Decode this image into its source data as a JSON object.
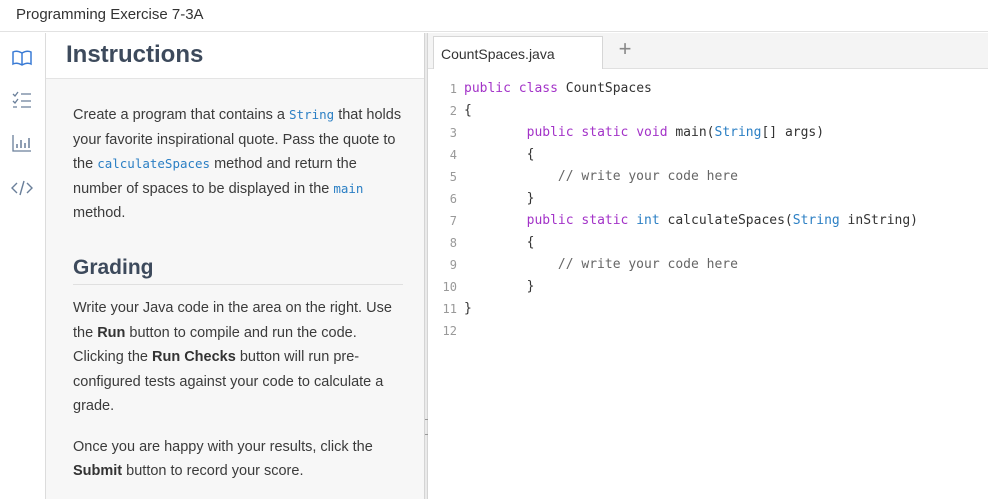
{
  "window": {
    "title": "Programming Exercise 7-3A"
  },
  "rail": {
    "icons": [
      "book-icon",
      "checklist-icon",
      "chart-icon",
      "code-icon"
    ]
  },
  "instructions": {
    "heading": "Instructions",
    "intro": [
      "Create a program that contains a ",
      "String",
      " that holds your favorite inspirational quote. Pass the quote to the ",
      "calculateSpaces",
      " method and return the number of spaces to be displayed in the ",
      "main",
      " method."
    ],
    "grading_heading": "Grading",
    "grading": [
      "Write your Java code in the area on the right. Use the ",
      "Run",
      " button to compile and run the code. Clicking the ",
      "Run Checks",
      " button will run pre-configured tests against your code to calculate a grade."
    ],
    "closing": [
      "Once you are happy with your results, click the ",
      "Submit",
      " button to record your score."
    ]
  },
  "editor": {
    "tab_label": "CountSpaces.java",
    "add_tab": "+",
    "lines": [
      {
        "n": "1",
        "tokens": [
          [
            "kw",
            "public"
          ],
          [
            "",
            ""
          ],
          [
            "",
            ""
          ],
          [
            "",
            " "
          ],
          [
            "kw",
            "class"
          ],
          [
            "",
            " CountSpaces"
          ]
        ]
      },
      {
        "n": "2",
        "tokens": [
          [
            "",
            "{"
          ]
        ]
      },
      {
        "n": "3",
        "tokens": [
          [
            "",
            "        "
          ],
          [
            "kw",
            "public"
          ],
          [
            "",
            " "
          ],
          [
            "kw",
            "static"
          ],
          [
            "",
            " "
          ],
          [
            "kw",
            "void"
          ],
          [
            "",
            " main("
          ],
          [
            "ty",
            "String"
          ],
          [
            "",
            "[] args)"
          ]
        ]
      },
      {
        "n": "4",
        "tokens": [
          [
            "",
            "        {"
          ]
        ]
      },
      {
        "n": "5",
        "tokens": [
          [
            "cm",
            "            // write your code here"
          ]
        ]
      },
      {
        "n": "6",
        "tokens": [
          [
            "",
            "        }"
          ]
        ]
      },
      {
        "n": "7",
        "tokens": [
          [
            "",
            "        "
          ],
          [
            "kw",
            "public"
          ],
          [
            "",
            " "
          ],
          [
            "kw",
            "static"
          ],
          [
            "",
            " "
          ],
          [
            "ty",
            "int"
          ],
          [
            "",
            " calculateSpaces("
          ],
          [
            "ty",
            "String"
          ],
          [
            "",
            " inString)"
          ]
        ]
      },
      {
        "n": "8",
        "tokens": [
          [
            "",
            "        {"
          ]
        ]
      },
      {
        "n": "9",
        "tokens": [
          [
            "cm",
            "            // write your code here"
          ]
        ]
      },
      {
        "n": "10",
        "tokens": [
          [
            "",
            "        }"
          ]
        ]
      },
      {
        "n": "11",
        "tokens": [
          [
            "",
            "}"
          ]
        ]
      },
      {
        "n": "12",
        "tokens": []
      }
    ]
  }
}
